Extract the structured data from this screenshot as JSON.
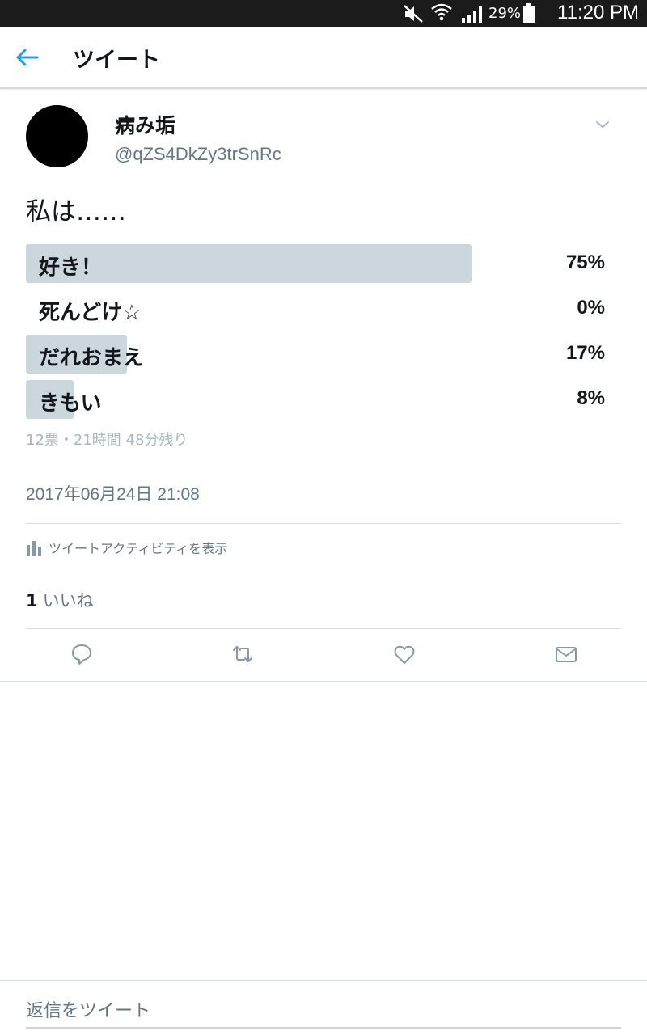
{
  "status_bar": {
    "battery_percent": "29%",
    "time": "11:20 PM",
    "icons": [
      "mute-icon",
      "wifi-icon",
      "signal-icon",
      "battery-icon"
    ]
  },
  "app_bar": {
    "title": "ツイート",
    "back_icon": "arrow-left-icon"
  },
  "tweet": {
    "display_name": "病み垢",
    "handle": "@qZS4DkZy3trSnRc",
    "text": "私は……",
    "menu_icon": "chevron-down-icon"
  },
  "poll": {
    "options": [
      {
        "label": "好き！",
        "percent_text": "75%",
        "percent": 75
      },
      {
        "label": "死んどけ☆",
        "percent_text": "0%",
        "percent": 0
      },
      {
        "label": "だれおまえ",
        "percent_text": "17%",
        "percent": 17
      },
      {
        "label": "きもい",
        "percent_text": "8%",
        "percent": 8
      }
    ],
    "meta": "12票・21時間 48分残り"
  },
  "timestamp": "2017年06月24日 21:08",
  "activity": {
    "label": "ツイートアクティビティを表示",
    "icon": "bar-chart-icon"
  },
  "likes": {
    "count": "1",
    "label": "いいね"
  },
  "actions": [
    "reply-icon",
    "retweet-icon",
    "like-icon",
    "message-icon"
  ],
  "reply_bar": {
    "placeholder": "返信をツイート"
  },
  "colors": {
    "accent": "#1da1f2",
    "poll_bar": "#ccd6dd",
    "secondary_text": "#657786",
    "status_bar": "#1b1b1b"
  }
}
